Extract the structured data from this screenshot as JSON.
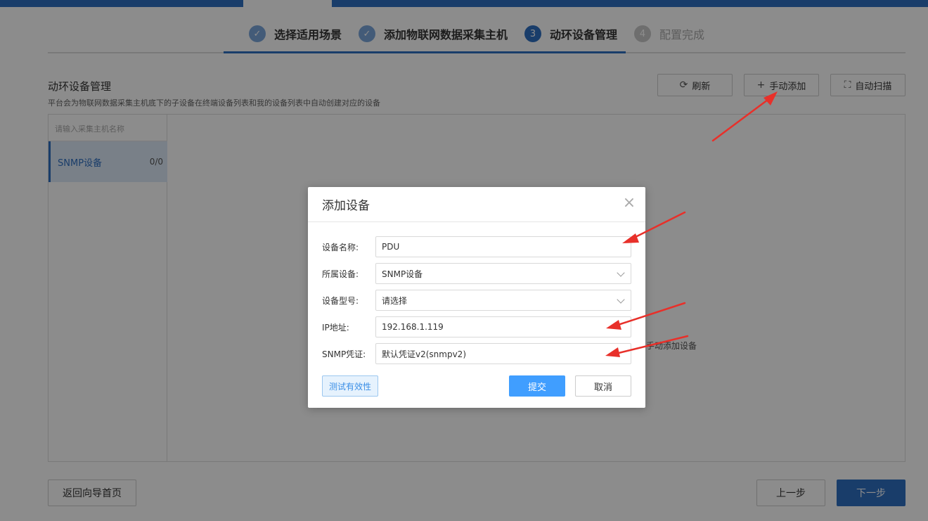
{
  "steps": [
    {
      "num": "",
      "label": "选择适用场景",
      "state": "done"
    },
    {
      "num": "",
      "label": "添加物联网数据采集主机",
      "state": "done"
    },
    {
      "num": "3",
      "label": "动环设备管理",
      "state": "active"
    },
    {
      "num": "4",
      "label": "配置完成",
      "state": "pending"
    }
  ],
  "section": {
    "title": "动环设备管理",
    "desc": "平台会为物联网数据采集主机底下的子设备在终端设备列表和我的设备列表中自动创建对应的设备"
  },
  "toolbar": {
    "refresh": "刷新",
    "manual_add": "手动添加",
    "auto_scan": "自动扫描"
  },
  "host_panel": {
    "search_placeholder": "请输入采集主机名称",
    "item_name": "SNMP设备",
    "item_count": "0/0"
  },
  "empty_hint": "手动添加设备",
  "footer": {
    "back_home": "返回向导首页",
    "prev": "上一步",
    "next": "下一步"
  },
  "modal": {
    "title": "添加设备",
    "close": "×",
    "fields": {
      "name_label": "设备名称:",
      "name_value": "PDU",
      "parent_label": "所属设备:",
      "parent_value": "SNMP设备",
      "model_label": "设备型号:",
      "model_value": "请选择",
      "ip_label": "IP地址:",
      "ip_value": "192.168.1.119",
      "cred_label": "SNMP凭证:",
      "cred_value": "默认凭证v2(snmpv2)"
    },
    "test_button": "测试有效性",
    "submit_button": "提交",
    "cancel_button": "取消"
  },
  "colors": {
    "primary": "#2f6fc2",
    "submit": "#409eff",
    "annotation_arrow": "#e8302a"
  }
}
